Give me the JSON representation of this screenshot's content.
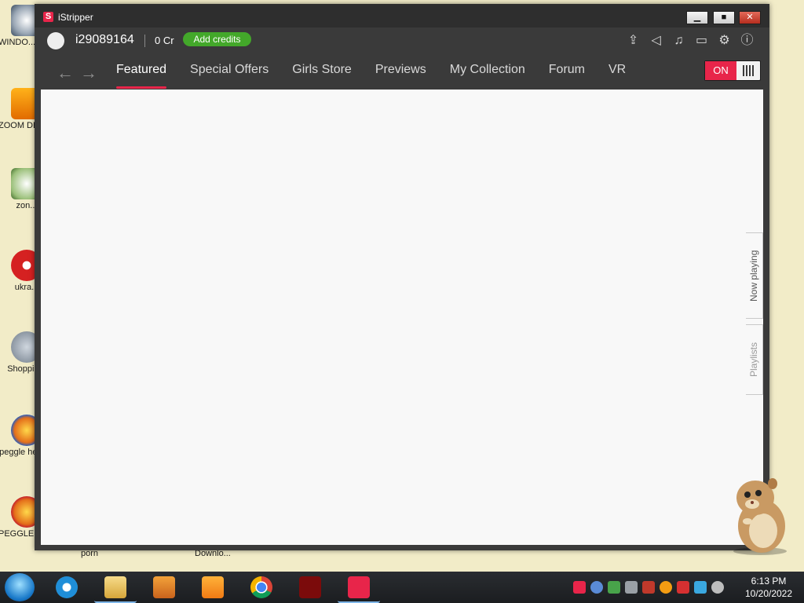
{
  "desktop": {
    "icons": [
      {
        "label": "WINDO... VIST..."
      },
      {
        "label": "ZOOM DELU..."
      },
      {
        "label": "zon..."
      },
      {
        "label": "ukra..."
      },
      {
        "label": "Shoppin..."
      },
      {
        "label": "peggle hego..."
      },
      {
        "label": "PEGGLE NECKBEA..."
      }
    ],
    "bottom_labels": [
      "porn",
      "Downlo..."
    ]
  },
  "window": {
    "title": "iStripper",
    "logo": "S",
    "controls": {
      "minimize": "▁",
      "maximize": "■",
      "close": "✕"
    },
    "account": {
      "username": "i29089164",
      "credits": "0 Cr",
      "add_credits_label": "Add credits"
    },
    "top_icons": [
      "upload-icon",
      "announcement-icon",
      "music-icon",
      "display-icon",
      "settings-icon",
      "info-icon"
    ],
    "nav": {
      "tabs": [
        {
          "label": "Featured",
          "active": true
        },
        {
          "label": "Special Offers"
        },
        {
          "label": "Girls Store"
        },
        {
          "label": "Previews"
        },
        {
          "label": "My Collection"
        },
        {
          "label": "Forum"
        },
        {
          "label": "VR"
        }
      ],
      "toggle_label": "ON"
    },
    "side_tabs": {
      "now_playing": "Now playing",
      "playlists": "Playlists"
    }
  },
  "taskbar": {
    "apps": [
      "internet-explorer-icon",
      "file-explorer-icon",
      "media-player-icon",
      "uc-browser-icon",
      "chrome-icon",
      "flash-icon",
      "istripper-icon"
    ],
    "clock": {
      "time": "6:13 PM",
      "date": "10/20/2022"
    }
  },
  "colors": {
    "accent": "#e8254a",
    "credits_button": "#43a82a",
    "window_bg": "#3a3a3a",
    "desktop_bg": "#f2ecc8"
  }
}
